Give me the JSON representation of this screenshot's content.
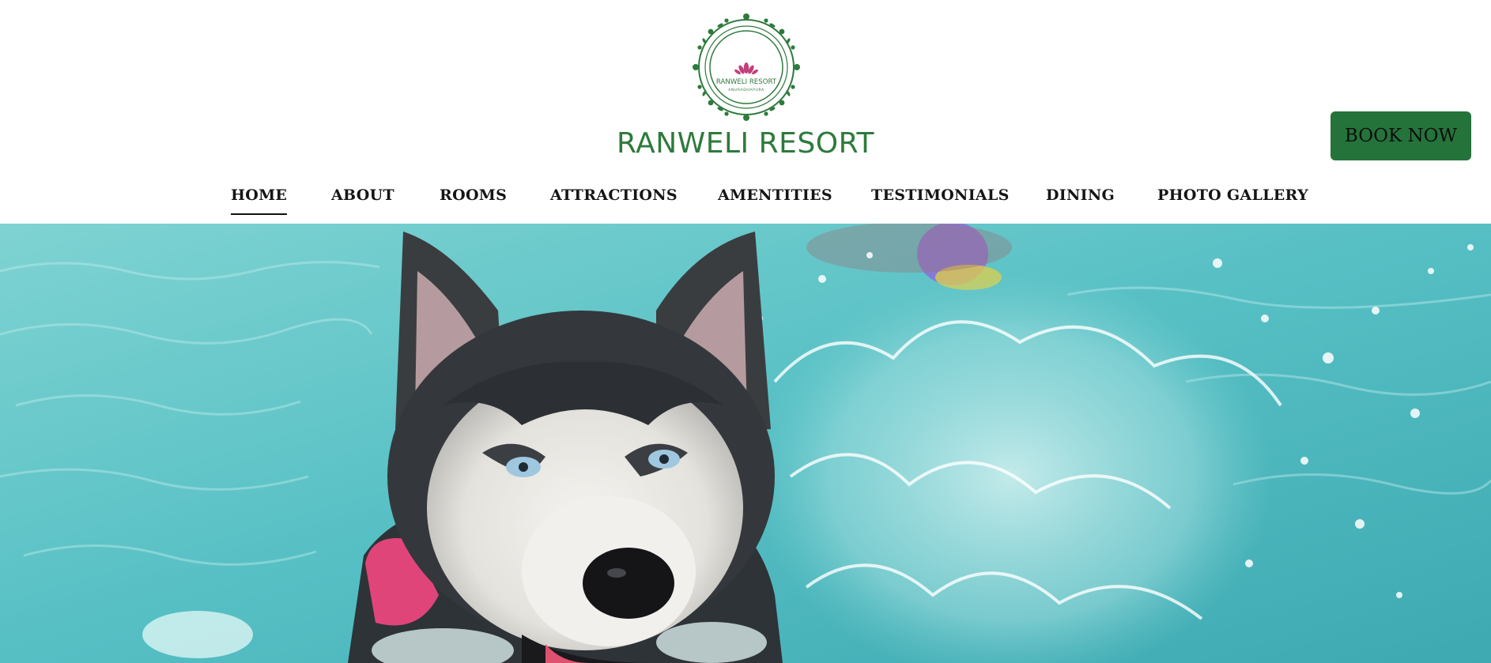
{
  "header": {
    "logo": {
      "icon": "lotus-wreath-logo",
      "emblem_text_main": "RANWELI RESORT",
      "emblem_text_sub": "ANURADHAPURA"
    },
    "brand_name": "RANWELI RESORT",
    "book_button": "BOOK NOW"
  },
  "nav": {
    "items": [
      {
        "label": "HOME",
        "active": true
      },
      {
        "label": "ABOUT",
        "active": false
      },
      {
        "label": "ROOMS",
        "active": false
      },
      {
        "label": "ATTRACTIONS",
        "active": false
      },
      {
        "label": "AMENTITIES",
        "active": false
      },
      {
        "label": "TESTIMONIALS",
        "active": false
      },
      {
        "label": "DINING",
        "active": false
      },
      {
        "label": "PHOTO GALLERY",
        "active": false
      }
    ]
  },
  "hero": {
    "image": "husky-swimming-in-pool-photo"
  },
  "colors": {
    "brand_green": "#2e7a3c",
    "button_green": "#24733a",
    "water": "#5cc4c8"
  }
}
